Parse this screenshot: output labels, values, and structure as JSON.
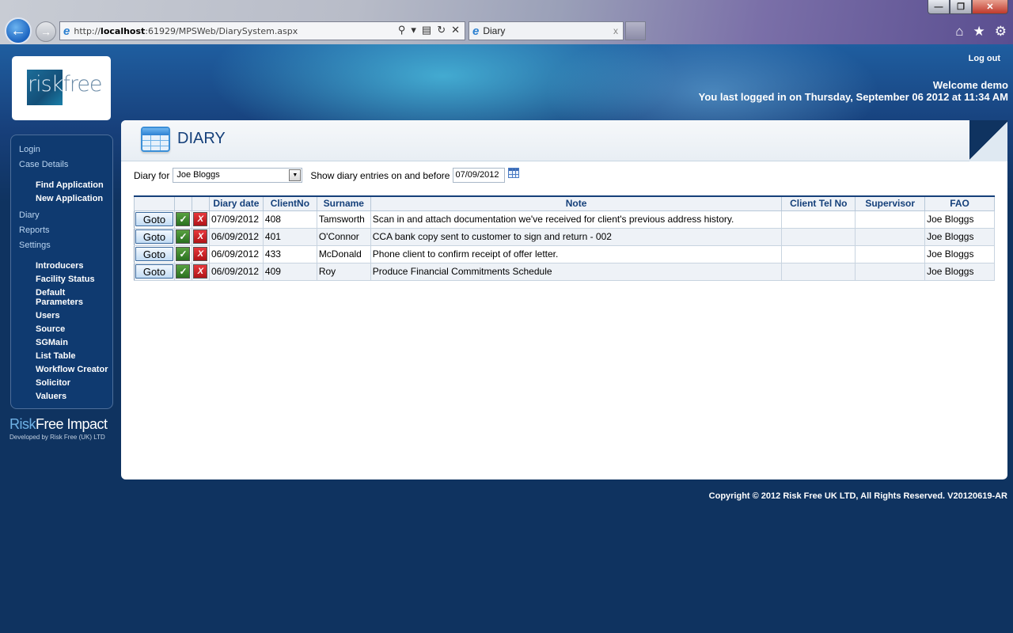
{
  "browser": {
    "url_prefix": "http://",
    "url_host": "localhost",
    "url_rest": ":61929/MPSWeb/DiarySystem.aspx",
    "tab_title": "Diary",
    "icons": {
      "back": "←",
      "forward": "→",
      "search": "⚲",
      "dropdown": "▾",
      "compat": "▤",
      "refresh": "↻",
      "stop": "✕",
      "home": "⌂",
      "favorites": "★",
      "tools": "⚙",
      "ie": "e",
      "tab_close": "x"
    },
    "window": {
      "minimize": "—",
      "restore": "❐",
      "close": "✕"
    }
  },
  "header": {
    "logout": "Log out",
    "welcome": "Welcome demo",
    "last_login": "You last logged in on Thursday, September 06 2012 at 11:34 AM"
  },
  "logo": {
    "part1": "risk",
    "part2": "free"
  },
  "sidebar": {
    "login": "Login",
    "case_details": "Case Details",
    "case_sub": [
      "Find Application",
      "New Application"
    ],
    "diary": "Diary",
    "reports": "Reports",
    "settings": "Settings",
    "settings_sub": [
      "Introducers",
      "Facility Status",
      "Default Parameters",
      "Users",
      "Source",
      "SGMain",
      "List Table",
      "Workflow Creator",
      "Solicitor",
      "Valuers"
    ]
  },
  "brand": {
    "part1": "Risk",
    "part2": "Free Impact",
    "sub": "Developed by Risk Free (UK) LTD"
  },
  "panel": {
    "title": "DIARY",
    "diary_for_label": "Diary for",
    "diary_for_value": "Joe Bloggs",
    "show_label": "Show diary entries on and before",
    "date_value": "07/09/2012"
  },
  "table": {
    "headers": [
      "",
      "",
      "",
      "Diary date",
      "ClientNo",
      "Surname",
      "Note",
      "Client Tel No",
      "Supervisor",
      "FAO"
    ],
    "goto_label": "Goto",
    "complete_glyph": "✓",
    "delete_glyph": "X",
    "rows": [
      {
        "date": "07/09/2012",
        "client_no": "408",
        "surname": "Tamsworth",
        "note": "Scan in and attach documentation we've received for client's previous address history.",
        "tel": "",
        "supervisor": "",
        "fao": "Joe Bloggs"
      },
      {
        "date": "06/09/2012",
        "client_no": "401",
        "surname": "O'Connor",
        "note": "CCA bank copy sent to customer to sign and return - 002",
        "tel": "",
        "supervisor": "",
        "fao": "Joe Bloggs"
      },
      {
        "date": "06/09/2012",
        "client_no": "433",
        "surname": "McDonald",
        "note": "Phone client to confirm receipt of offer letter.",
        "tel": "",
        "supervisor": "",
        "fao": "Joe Bloggs"
      },
      {
        "date": "06/09/2012",
        "client_no": "409",
        "surname": "Roy",
        "note": "Produce Financial Commitments Schedule",
        "tel": "",
        "supervisor": "",
        "fao": "Joe Bloggs"
      }
    ]
  },
  "footer": "Copyright © 2012 Risk Free UK LTD, All Rights Reserved. V20120619-AR"
}
